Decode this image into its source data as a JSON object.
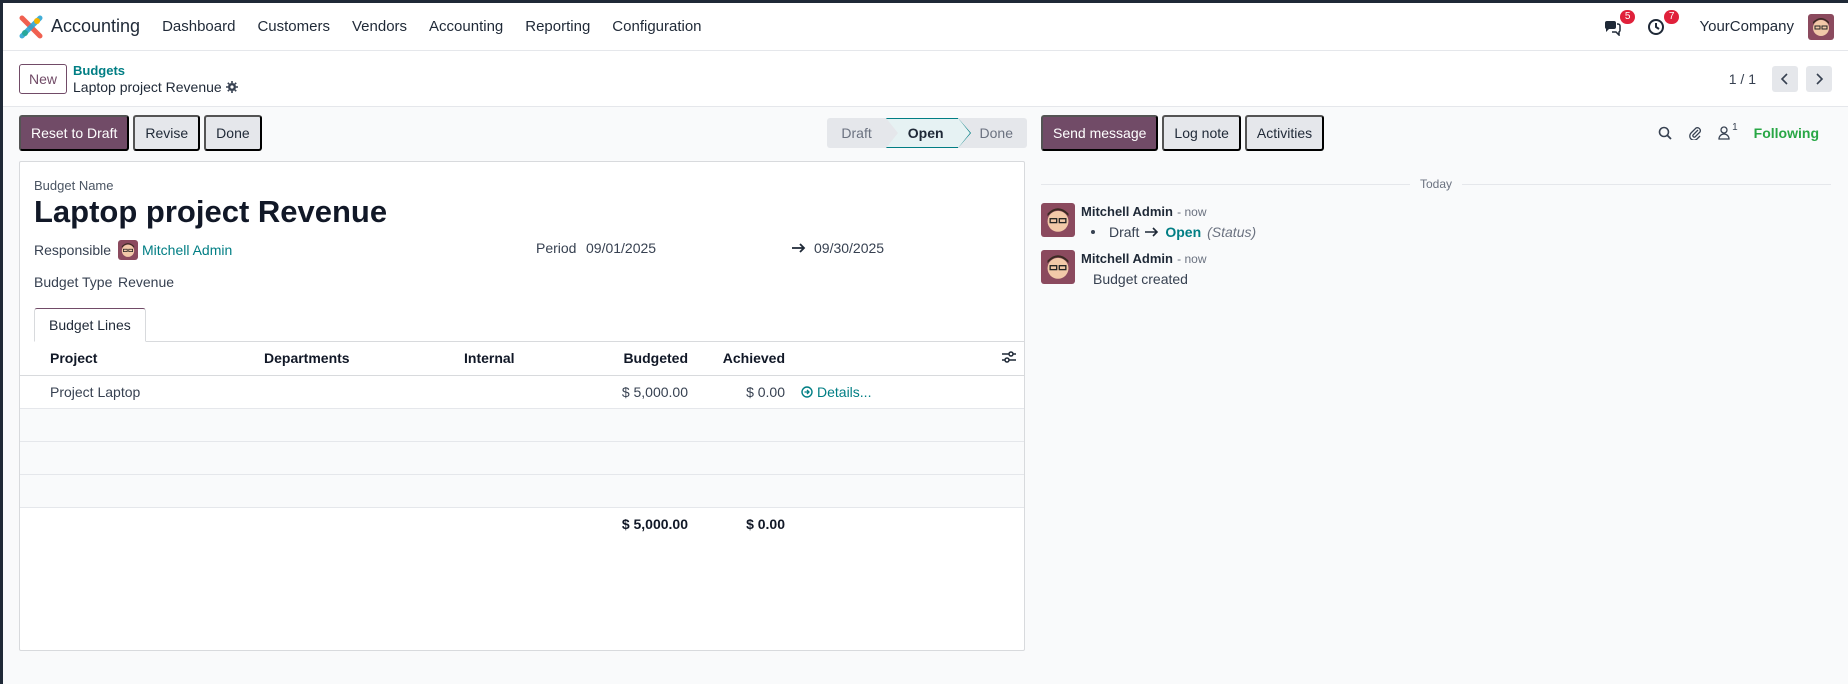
{
  "navbar": {
    "app_name": "Accounting",
    "menu": [
      "Dashboard",
      "Customers",
      "Vendors",
      "Accounting",
      "Reporting",
      "Configuration"
    ],
    "messages_count": "5",
    "activities_count": "7",
    "company": "YourCompany"
  },
  "control_panel": {
    "new_label": "New",
    "breadcrumb_parent": "Budgets",
    "breadcrumb_current": "Laptop project Revenue",
    "pager_value": "1 / 1"
  },
  "statusbar": {
    "reset_label": "Reset to Draft",
    "revise_label": "Revise",
    "done_label": "Done",
    "steps": [
      "Draft",
      "Open",
      "Done"
    ],
    "active_step": "Open"
  },
  "form": {
    "budget_name_label": "Budget Name",
    "budget_name": "Laptop project Revenue",
    "responsible_label": "Responsible",
    "responsible": "Mitchell Admin",
    "period_label": "Period",
    "date_from": "09/01/2025",
    "date_to": "09/30/2025",
    "budget_type_label": "Budget Type",
    "budget_type": "Revenue",
    "tab_label": "Budget Lines"
  },
  "lines": {
    "headers": {
      "project": "Project",
      "departments": "Departments",
      "internal": "Internal",
      "budgeted": "Budgeted",
      "achieved": "Achieved"
    },
    "rows": [
      {
        "project": "Project Laptop",
        "departments": "",
        "internal": "",
        "budgeted": "$ 5,000.00",
        "achieved": "$ 0.00",
        "details": "Details..."
      }
    ],
    "total_budgeted": "$ 5,000.00",
    "total_achieved": "$ 0.00"
  },
  "chatter": {
    "send_message_label": "Send message",
    "log_note_label": "Log note",
    "activities_label": "Activities",
    "followers_count": "1",
    "following_label": "Following",
    "day_separator": "Today",
    "messages": [
      {
        "author": "Mitchell Admin",
        "date": "- now",
        "old_value": "Draft",
        "new_value": "Open",
        "field": "(Status)"
      },
      {
        "author": "Mitchell Admin",
        "date": "- now",
        "body": "Budget created"
      }
    ]
  },
  "colors": {
    "brand": "#714b67",
    "link": "#017e84",
    "following": "#28a745",
    "badge": "#e0213b"
  }
}
